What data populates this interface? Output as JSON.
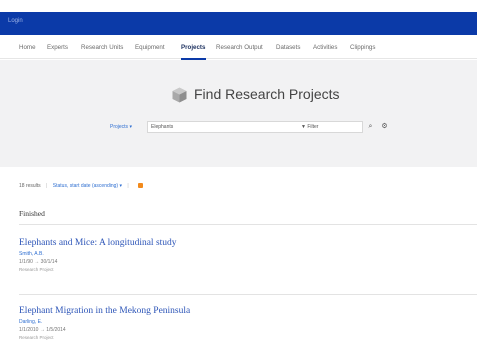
{
  "header": {
    "logo": "Login"
  },
  "nav": {
    "items": [
      {
        "label": "Home"
      },
      {
        "label": "Experts"
      },
      {
        "label": "Research Units"
      },
      {
        "label": "Equipment"
      },
      {
        "label": "Projects"
      },
      {
        "label": "Research Output"
      },
      {
        "label": "Datasets"
      },
      {
        "label": "Activities"
      },
      {
        "label": "Clippings"
      }
    ],
    "active": "Projects"
  },
  "hero": {
    "title": "Find Research Projects"
  },
  "search": {
    "scope": "Projects ▾",
    "query": "Elephants",
    "filter_label": "Filter",
    "search_glyph": "⌕",
    "settings_glyph": "⚙"
  },
  "results": {
    "count": "18 results",
    "sort": "Status, start date (ascending) ▾"
  },
  "section": {
    "title": "Finished"
  },
  "items": [
    {
      "title": "Elephants and Mice: A longitudinal study",
      "person": "Smith, A.B.",
      "date": "1/1/90 → 30/1/14",
      "type": "Research Project"
    },
    {
      "title": "Elephant Migration in the Mekong Peninsula",
      "person": "Darling, E.",
      "date": "1/1/2010 → 1/5/2014",
      "type": "Research Project"
    }
  ],
  "colors": {
    "brand": "#0b3aa8",
    "link": "#2f6fd1",
    "rss": "#f28a1c"
  }
}
